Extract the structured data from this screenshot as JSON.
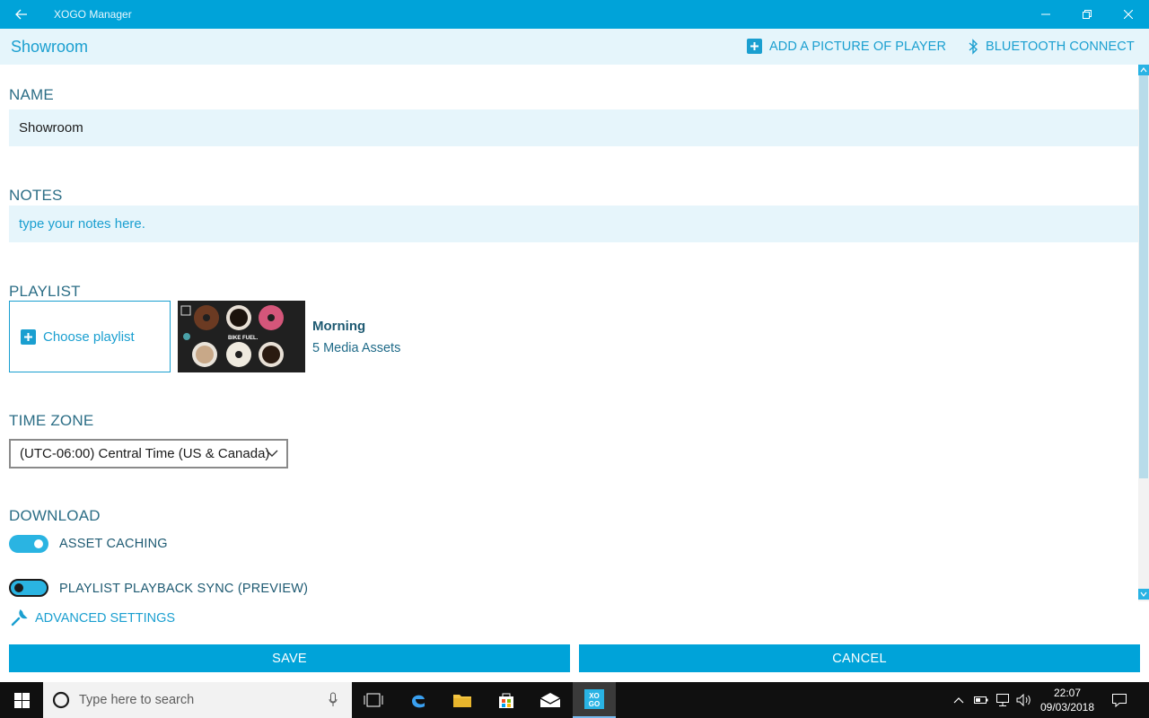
{
  "window": {
    "title": "XOGO Manager"
  },
  "header": {
    "page_title": "Showroom",
    "add_picture_label": "ADD A PICTURE OF PLAYER",
    "bluetooth_label": "BLUETOOTH CONNECT"
  },
  "form": {
    "name": {
      "label": "NAME",
      "value": "Showroom"
    },
    "notes": {
      "label": "NOTES",
      "placeholder": "type your notes here.",
      "value": ""
    },
    "playlist": {
      "label": "PLAYLIST",
      "choose_label": "Choose playlist",
      "selected_name": "Morning",
      "selected_assets": "5 Media Assets",
      "thumbnail_caption": "BIKE FUEL."
    },
    "time_zone": {
      "label": "TIME ZONE",
      "selected": "(UTC-06:00) Central Time (US & Canada)"
    },
    "download": {
      "label": "DOWNLOAD",
      "asset_caching": {
        "label": "ASSET CACHING",
        "on": true
      },
      "playback_sync": {
        "label": "PLAYLIST PLAYBACK SYNC (PREVIEW)",
        "on": true
      }
    },
    "advanced_label": "ADVANCED SETTINGS"
  },
  "actions": {
    "save_label": "SAVE",
    "cancel_label": "CANCEL"
  },
  "taskbar": {
    "search_placeholder": "Type here to search",
    "time": "22:07",
    "date": "09/03/2018",
    "pinned_app_label": "XO GO"
  },
  "colors": {
    "accent": "#00a3d9",
    "field_bg": "#e6f5fb",
    "label": "#2c6e86",
    "taskbar": "#101010"
  }
}
